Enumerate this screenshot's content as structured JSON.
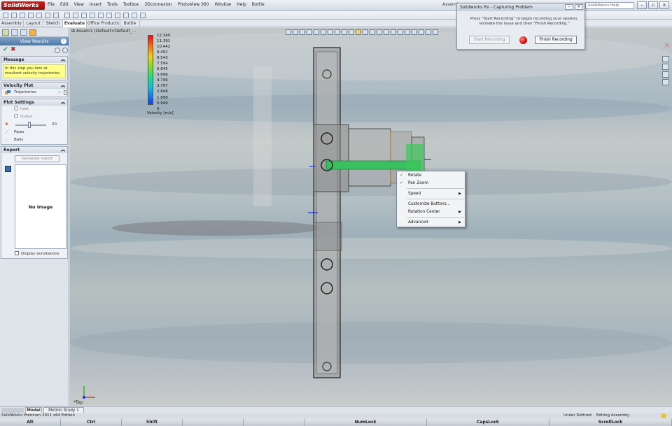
{
  "app": {
    "logo": "SolidWorks",
    "menu": [
      "File",
      "Edit",
      "View",
      "Insert",
      "Tools",
      "Toolbox",
      "3Dconnexion",
      "PhotoView 360",
      "Window",
      "Help",
      "Bottle"
    ],
    "title_right": "Assem1",
    "search_placeholder": "SolidWorks Help"
  },
  "command_tabs": [
    "Assembly",
    "Layout",
    "Sketch",
    "Evaluate",
    "Office Products",
    "Bottle"
  ],
  "left_panel": {
    "title": "View Results",
    "help": "?",
    "message_head": "Message",
    "message": "In this step you look at resultant velocity trajectories.",
    "velocity_head": "Velocity Plot",
    "trajectories": "Trajectories",
    "plot_head": "Plot Settings",
    "inlet": "Inlet",
    "outlet": "Outlet",
    "slider_value": "20",
    "pipes": "Pipes",
    "balls": "Balls",
    "report_head": "Report",
    "generate": "Generate report",
    "no_image": "No Image",
    "display_annotations": "Display annotations"
  },
  "viewport": {
    "tree_item": "Assem1  (Default<Default_...",
    "legend_values": [
      "12.340",
      "11.391",
      "10.442",
      "9.492",
      "8.543",
      "7.594",
      "6.645",
      "5.696",
      "4.746",
      "3.797",
      "2.848",
      "1.898",
      "0.949",
      "0"
    ],
    "legend_title": "Velocity [m/s]",
    "triad_label": "*Top"
  },
  "context_menu": {
    "items": [
      {
        "label": "Rotate",
        "checked": true
      },
      {
        "label": "Pan Zoom",
        "checked": true
      },
      {
        "label": "Speed",
        "submenu": true
      },
      {
        "label": "Customize Buttons..."
      },
      {
        "label": "Rotation Center",
        "submenu": true
      },
      {
        "label": "Advanced",
        "submenu": true
      }
    ]
  },
  "rx_dialog": {
    "title": "Solidworks Rx - Capturing Problem",
    "text": "Press \"Start Recording\" to begin recording your session, recreate the issue and then \"Finish Recording.\"",
    "start": "Start Recording",
    "finish": "Finish Recording"
  },
  "bottom_tabs": [
    "Model",
    "Motion Study 1"
  ],
  "status": {
    "left": "SolidWorks Premium 2011 x64 Edition",
    "defined": "Under Defined",
    "mode": "Editing Assembly"
  },
  "keys": [
    "Alt",
    "Ctrl",
    "Shift",
    "",
    "",
    "NumLock",
    "CapsLock",
    "ScrollLock"
  ],
  "colors": {
    "accent": "#4f78a6",
    "message_bg": "#ffff8a",
    "record": "#d01010"
  }
}
